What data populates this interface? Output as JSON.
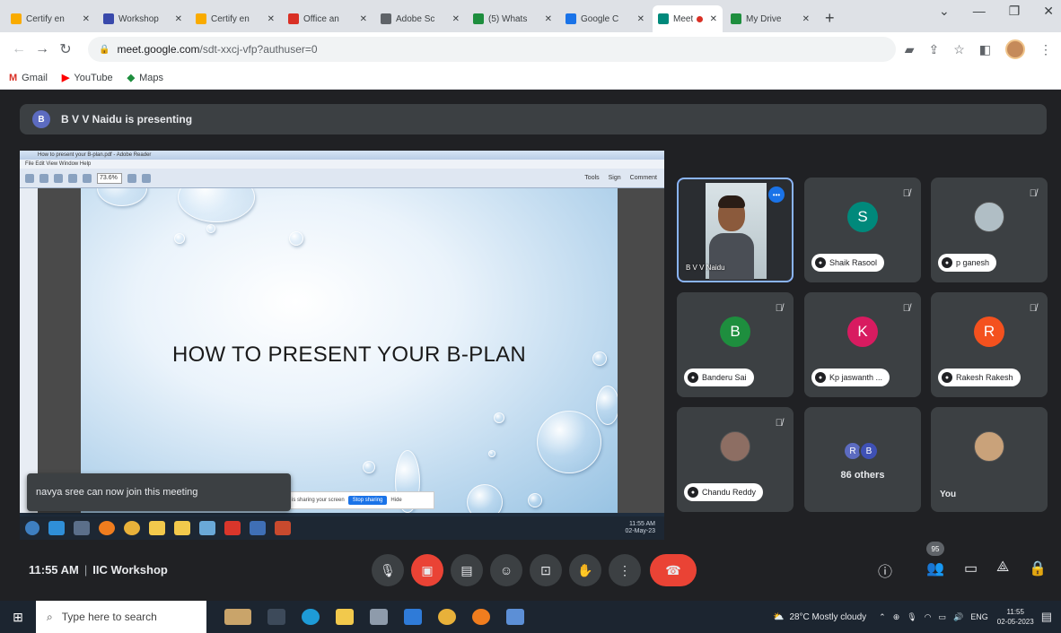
{
  "browser": {
    "tabs": [
      {
        "title": "Certify en",
        "color": "#f9ab00"
      },
      {
        "title": "Workshop",
        "color": "#3949ab"
      },
      {
        "title": "Certify en",
        "color": "#f9ab00"
      },
      {
        "title": "Office an",
        "color": "#d93025"
      },
      {
        "title": "Adobe Sc",
        "color": "#5f6368"
      },
      {
        "title": "(5) Whats",
        "color": "#1e8e3e"
      },
      {
        "title": "Google C",
        "color": "#1a73e8"
      },
      {
        "title": "Meet",
        "color": "#00897b",
        "active": true
      },
      {
        "title": "My Drive",
        "color": "#1e8e3e"
      }
    ],
    "url_host": "meet.google.com",
    "url_path": "/sdt-xxcj-vfp?authuser=0",
    "bookmarks": [
      {
        "label": "Gmail",
        "icon": "M",
        "color": "#d93025"
      },
      {
        "label": "YouTube",
        "icon": "▶",
        "color": "#ff0000"
      },
      {
        "label": "Maps",
        "icon": "◆",
        "color": "#1e8e3e"
      }
    ]
  },
  "meet": {
    "presenter_initial": "B",
    "presenting_text": "B V V Naidu is presenting",
    "slide_title": "HOW TO PRESENT YOUR B-PLAN",
    "toast": "navya sree can now join this meeting",
    "time": "11:55 AM",
    "meeting_name": "IIC Workshop",
    "people_count": "95",
    "participants": [
      {
        "name": "B V V Naidu",
        "type": "video"
      },
      {
        "name": "Shaik Rasool",
        "initial": "S",
        "color": "#00897b"
      },
      {
        "name": "p ganesh",
        "initial": "",
        "color": "#b0bec5",
        "photo": true
      },
      {
        "name": "Banderu Sai",
        "initial": "B",
        "color": "#1e8e3e"
      },
      {
        "name": "Kp jaswanth ...",
        "initial": "K",
        "color": "#d81b60"
      },
      {
        "name": "Rakesh Rakesh",
        "initial": "R",
        "color": "#f4511e"
      },
      {
        "name": "Chandu Reddy",
        "initial": "",
        "color": "#8d6e63",
        "photo": true
      },
      {
        "name": "86 others",
        "type": "others"
      },
      {
        "name": "You",
        "initial": "",
        "color": "#c9a27a",
        "photo": true
      }
    ],
    "others_initials": [
      "R",
      "B"
    ]
  },
  "shared_screen": {
    "reader_title": "How to present your B-plan.pdf - Adobe Reader",
    "menu": "File  Edit  View  Window  Help",
    "zoom": "73.6%",
    "tools": [
      "Tools",
      "Sign",
      "Comment"
    ],
    "share_notice": "is sharing your screen",
    "stop_sharing": "Stop sharing",
    "hide": "Hide",
    "clock_time": "11:55 AM",
    "clock_date": "02-May-23"
  },
  "taskbar": {
    "search_placeholder": "Type here to search",
    "weather": "28°C  Mostly cloudy",
    "lang": "ENG",
    "time": "11:55",
    "date": "02-05-2023"
  }
}
